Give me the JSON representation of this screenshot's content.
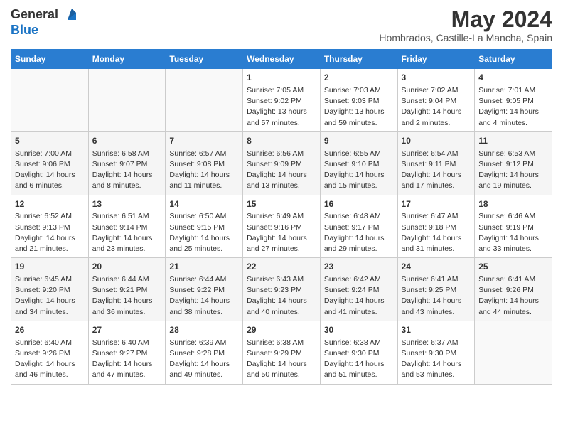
{
  "logo": {
    "line1": "General",
    "line2": "Blue"
  },
  "title": "May 2024",
  "location": "Hombrados, Castille-La Mancha, Spain",
  "headers": [
    "Sunday",
    "Monday",
    "Tuesday",
    "Wednesday",
    "Thursday",
    "Friday",
    "Saturday"
  ],
  "weeks": [
    [
      {
        "day": "",
        "info": ""
      },
      {
        "day": "",
        "info": ""
      },
      {
        "day": "",
        "info": ""
      },
      {
        "day": "1",
        "info": "Sunrise: 7:05 AM\nSunset: 9:02 PM\nDaylight: 13 hours\nand 57 minutes."
      },
      {
        "day": "2",
        "info": "Sunrise: 7:03 AM\nSunset: 9:03 PM\nDaylight: 13 hours\nand 59 minutes."
      },
      {
        "day": "3",
        "info": "Sunrise: 7:02 AM\nSunset: 9:04 PM\nDaylight: 14 hours\nand 2 minutes."
      },
      {
        "day": "4",
        "info": "Sunrise: 7:01 AM\nSunset: 9:05 PM\nDaylight: 14 hours\nand 4 minutes."
      }
    ],
    [
      {
        "day": "5",
        "info": "Sunrise: 7:00 AM\nSunset: 9:06 PM\nDaylight: 14 hours\nand 6 minutes."
      },
      {
        "day": "6",
        "info": "Sunrise: 6:58 AM\nSunset: 9:07 PM\nDaylight: 14 hours\nand 8 minutes."
      },
      {
        "day": "7",
        "info": "Sunrise: 6:57 AM\nSunset: 9:08 PM\nDaylight: 14 hours\nand 11 minutes."
      },
      {
        "day": "8",
        "info": "Sunrise: 6:56 AM\nSunset: 9:09 PM\nDaylight: 14 hours\nand 13 minutes."
      },
      {
        "day": "9",
        "info": "Sunrise: 6:55 AM\nSunset: 9:10 PM\nDaylight: 14 hours\nand 15 minutes."
      },
      {
        "day": "10",
        "info": "Sunrise: 6:54 AM\nSunset: 9:11 PM\nDaylight: 14 hours\nand 17 minutes."
      },
      {
        "day": "11",
        "info": "Sunrise: 6:53 AM\nSunset: 9:12 PM\nDaylight: 14 hours\nand 19 minutes."
      }
    ],
    [
      {
        "day": "12",
        "info": "Sunrise: 6:52 AM\nSunset: 9:13 PM\nDaylight: 14 hours\nand 21 minutes."
      },
      {
        "day": "13",
        "info": "Sunrise: 6:51 AM\nSunset: 9:14 PM\nDaylight: 14 hours\nand 23 minutes."
      },
      {
        "day": "14",
        "info": "Sunrise: 6:50 AM\nSunset: 9:15 PM\nDaylight: 14 hours\nand 25 minutes."
      },
      {
        "day": "15",
        "info": "Sunrise: 6:49 AM\nSunset: 9:16 PM\nDaylight: 14 hours\nand 27 minutes."
      },
      {
        "day": "16",
        "info": "Sunrise: 6:48 AM\nSunset: 9:17 PM\nDaylight: 14 hours\nand 29 minutes."
      },
      {
        "day": "17",
        "info": "Sunrise: 6:47 AM\nSunset: 9:18 PM\nDaylight: 14 hours\nand 31 minutes."
      },
      {
        "day": "18",
        "info": "Sunrise: 6:46 AM\nSunset: 9:19 PM\nDaylight: 14 hours\nand 33 minutes."
      }
    ],
    [
      {
        "day": "19",
        "info": "Sunrise: 6:45 AM\nSunset: 9:20 PM\nDaylight: 14 hours\nand 34 minutes."
      },
      {
        "day": "20",
        "info": "Sunrise: 6:44 AM\nSunset: 9:21 PM\nDaylight: 14 hours\nand 36 minutes."
      },
      {
        "day": "21",
        "info": "Sunrise: 6:44 AM\nSunset: 9:22 PM\nDaylight: 14 hours\nand 38 minutes."
      },
      {
        "day": "22",
        "info": "Sunrise: 6:43 AM\nSunset: 9:23 PM\nDaylight: 14 hours\nand 40 minutes."
      },
      {
        "day": "23",
        "info": "Sunrise: 6:42 AM\nSunset: 9:24 PM\nDaylight: 14 hours\nand 41 minutes."
      },
      {
        "day": "24",
        "info": "Sunrise: 6:41 AM\nSunset: 9:25 PM\nDaylight: 14 hours\nand 43 minutes."
      },
      {
        "day": "25",
        "info": "Sunrise: 6:41 AM\nSunset: 9:26 PM\nDaylight: 14 hours\nand 44 minutes."
      }
    ],
    [
      {
        "day": "26",
        "info": "Sunrise: 6:40 AM\nSunset: 9:26 PM\nDaylight: 14 hours\nand 46 minutes."
      },
      {
        "day": "27",
        "info": "Sunrise: 6:40 AM\nSunset: 9:27 PM\nDaylight: 14 hours\nand 47 minutes."
      },
      {
        "day": "28",
        "info": "Sunrise: 6:39 AM\nSunset: 9:28 PM\nDaylight: 14 hours\nand 49 minutes."
      },
      {
        "day": "29",
        "info": "Sunrise: 6:38 AM\nSunset: 9:29 PM\nDaylight: 14 hours\nand 50 minutes."
      },
      {
        "day": "30",
        "info": "Sunrise: 6:38 AM\nSunset: 9:30 PM\nDaylight: 14 hours\nand 51 minutes."
      },
      {
        "day": "31",
        "info": "Sunrise: 6:37 AM\nSunset: 9:30 PM\nDaylight: 14 hours\nand 53 minutes."
      },
      {
        "day": "",
        "info": ""
      }
    ]
  ]
}
